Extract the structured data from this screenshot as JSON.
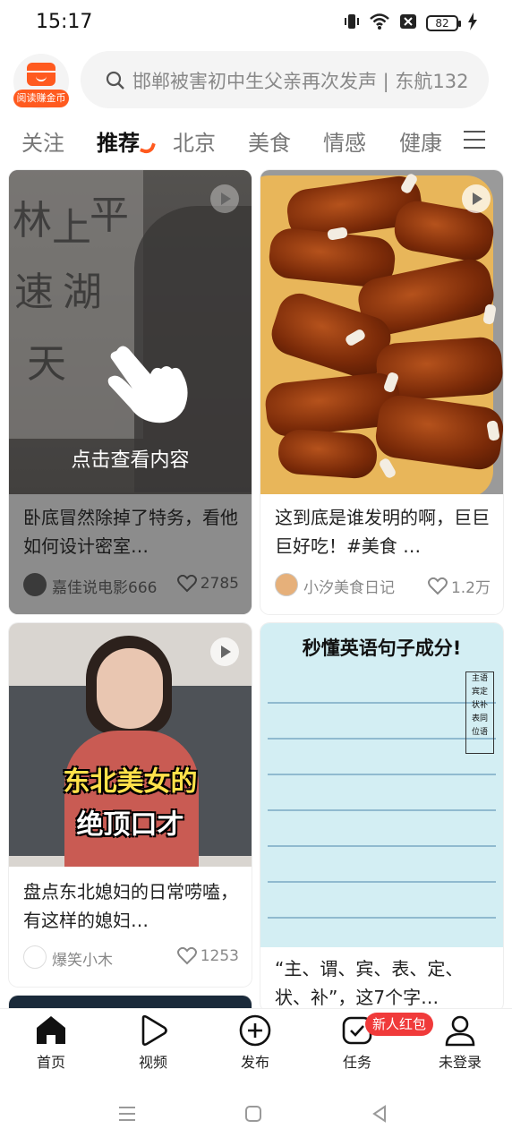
{
  "status_bar": {
    "time": "15:17",
    "battery": "82",
    "icons": [
      "vibrate-icon",
      "wifi-icon",
      "sim-off-icon",
      "battery-icon",
      "charging-icon"
    ]
  },
  "header": {
    "logo_label": "阅读赚金币",
    "search_placeholder": "邯郸被害初中生父亲再次发声 | 东航132"
  },
  "tabs": [
    {
      "label": "关注"
    },
    {
      "label": "推荐",
      "active": true
    },
    {
      "label": "北京"
    },
    {
      "label": "美食"
    },
    {
      "label": "情感"
    },
    {
      "label": "健康"
    }
  ],
  "cards": [
    {
      "hint": "点击查看内容",
      "title": "卧底冒然除掉了特务，看他如何设计密室…",
      "author": "嘉佳说电影666",
      "likes": "2785",
      "calligraphy": [
        "林",
        "上",
        "平",
        "速",
        "湖",
        "天"
      ]
    },
    {
      "title": "这到底是谁发明的啊，巨巨巨好吃！#美食 …",
      "author": "小汐美食日记",
      "likes": "1.2万"
    },
    {
      "caption_line1": "东北美女的",
      "caption_line2": "绝顶口才",
      "title": "盘点东北媳妇的日常唠嗑，有这样的媳妇…",
      "author": "爆笑小木",
      "likes": "1253"
    },
    {
      "image_title": "秒懂英语句子成分!",
      "side_box": [
        "主语",
        "宾定",
        "状补",
        "表同",
        "位语"
      ],
      "title": "“主、谓、宾、表、定、状、补”，这7个字…"
    }
  ],
  "bottom_nav": [
    {
      "label": "首页",
      "icon": "home-icon"
    },
    {
      "label": "视频",
      "icon": "video-play-icon"
    },
    {
      "label": "发布",
      "icon": "add-circle-icon"
    },
    {
      "label": "任务",
      "icon": "task-check-icon"
    },
    {
      "label": "未登录",
      "icon": "user-icon"
    }
  ],
  "task_badge": "新人红包",
  "colors": {
    "accent": "#ff5a1f",
    "badge": "#f03a3a",
    "muted_text": "#888888"
  }
}
